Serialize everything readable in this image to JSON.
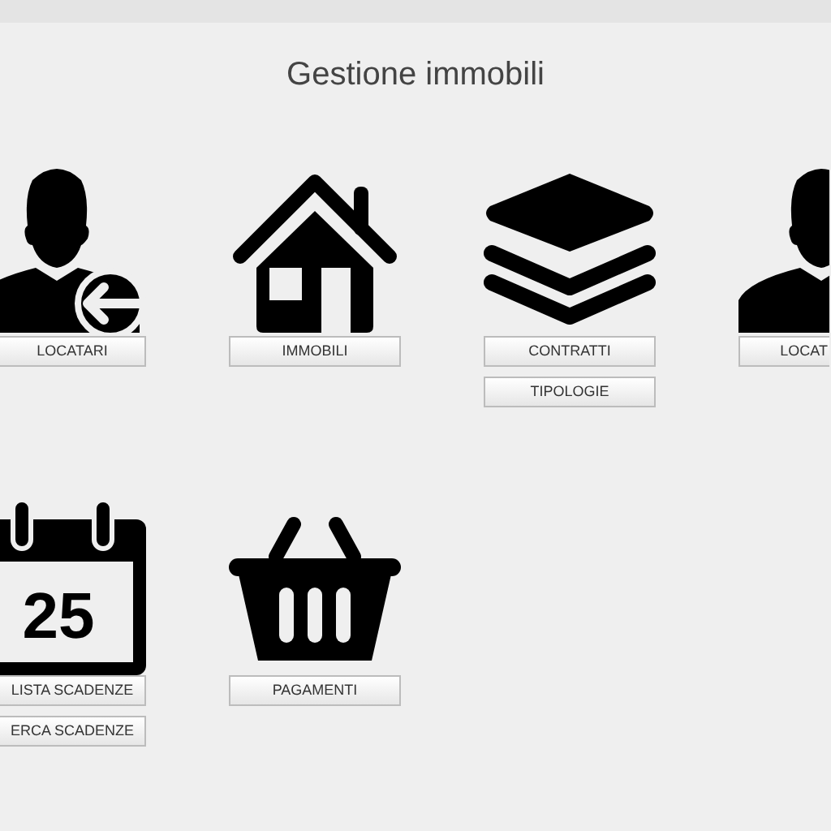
{
  "title": "Gestione immobili",
  "tiles": [
    {
      "kind": "user-arrow",
      "buttons": [
        "LOCATARI"
      ]
    },
    {
      "kind": "house",
      "buttons": [
        "IMMOBILI"
      ]
    },
    {
      "kind": "layers",
      "buttons": [
        "CONTRATTI",
        "TIPOLOGIE"
      ]
    },
    {
      "kind": "user",
      "buttons": [
        "LOCAT"
      ]
    },
    {
      "kind": "calendar",
      "day": "25",
      "buttons": [
        "LISTA SCADENZE",
        "ERCA SCADENZE"
      ]
    },
    {
      "kind": "basket",
      "buttons": [
        "PAGAMENTI"
      ]
    }
  ]
}
